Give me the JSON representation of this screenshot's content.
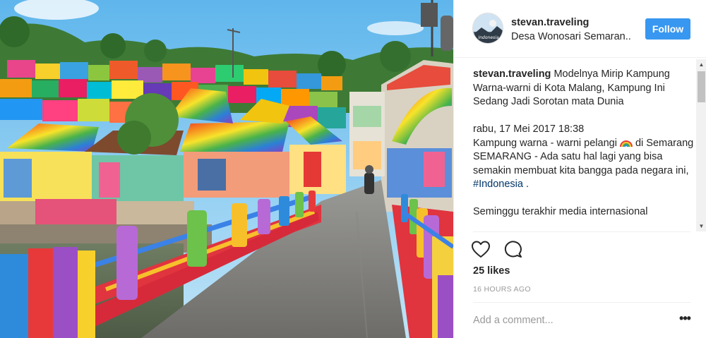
{
  "post": {
    "photo_subject": "rainbow-painted-village-photo",
    "avatar_badge_text": "Indonesia"
  },
  "header": {
    "username": "stevan.traveling",
    "location": "Desa Wonosari Semaran..",
    "follow_label": "Follow"
  },
  "caption": {
    "username": "stevan.traveling",
    "text": " Modelnya Mirip Kampung Warna-warni di Kota Malang, Kampung Ini Sedang Jadi Sorotan mata Dunia",
    "date_line": "rabu, 17 Mei 2017 18:38",
    "line_a": "Kampung warna - warni pelangi ",
    "line_a_emoji": "rainbow-emoji",
    "line_a_end": " di Semarang",
    "line_b_prefix": "SEMARANG - Ada satu hal lagi yang bisa semakin membuat kita bangga pada negara ini, ",
    "hashtag": "#Indonesia",
    "line_b_suffix": " .",
    "line_c": "Seminggu terakhir media internasional"
  },
  "actions": {
    "like_icon": "heart-icon",
    "comment_icon": "comment-icon"
  },
  "stats": {
    "likes": "25 likes",
    "time": "16 HOURS AGO"
  },
  "comment_box": {
    "placeholder": "Add a comment...",
    "more_icon": "more-options-icon"
  },
  "colors": {
    "follow_button": "#3897f0",
    "hashtag": "#003569",
    "muted": "#999999",
    "text": "#262626"
  }
}
